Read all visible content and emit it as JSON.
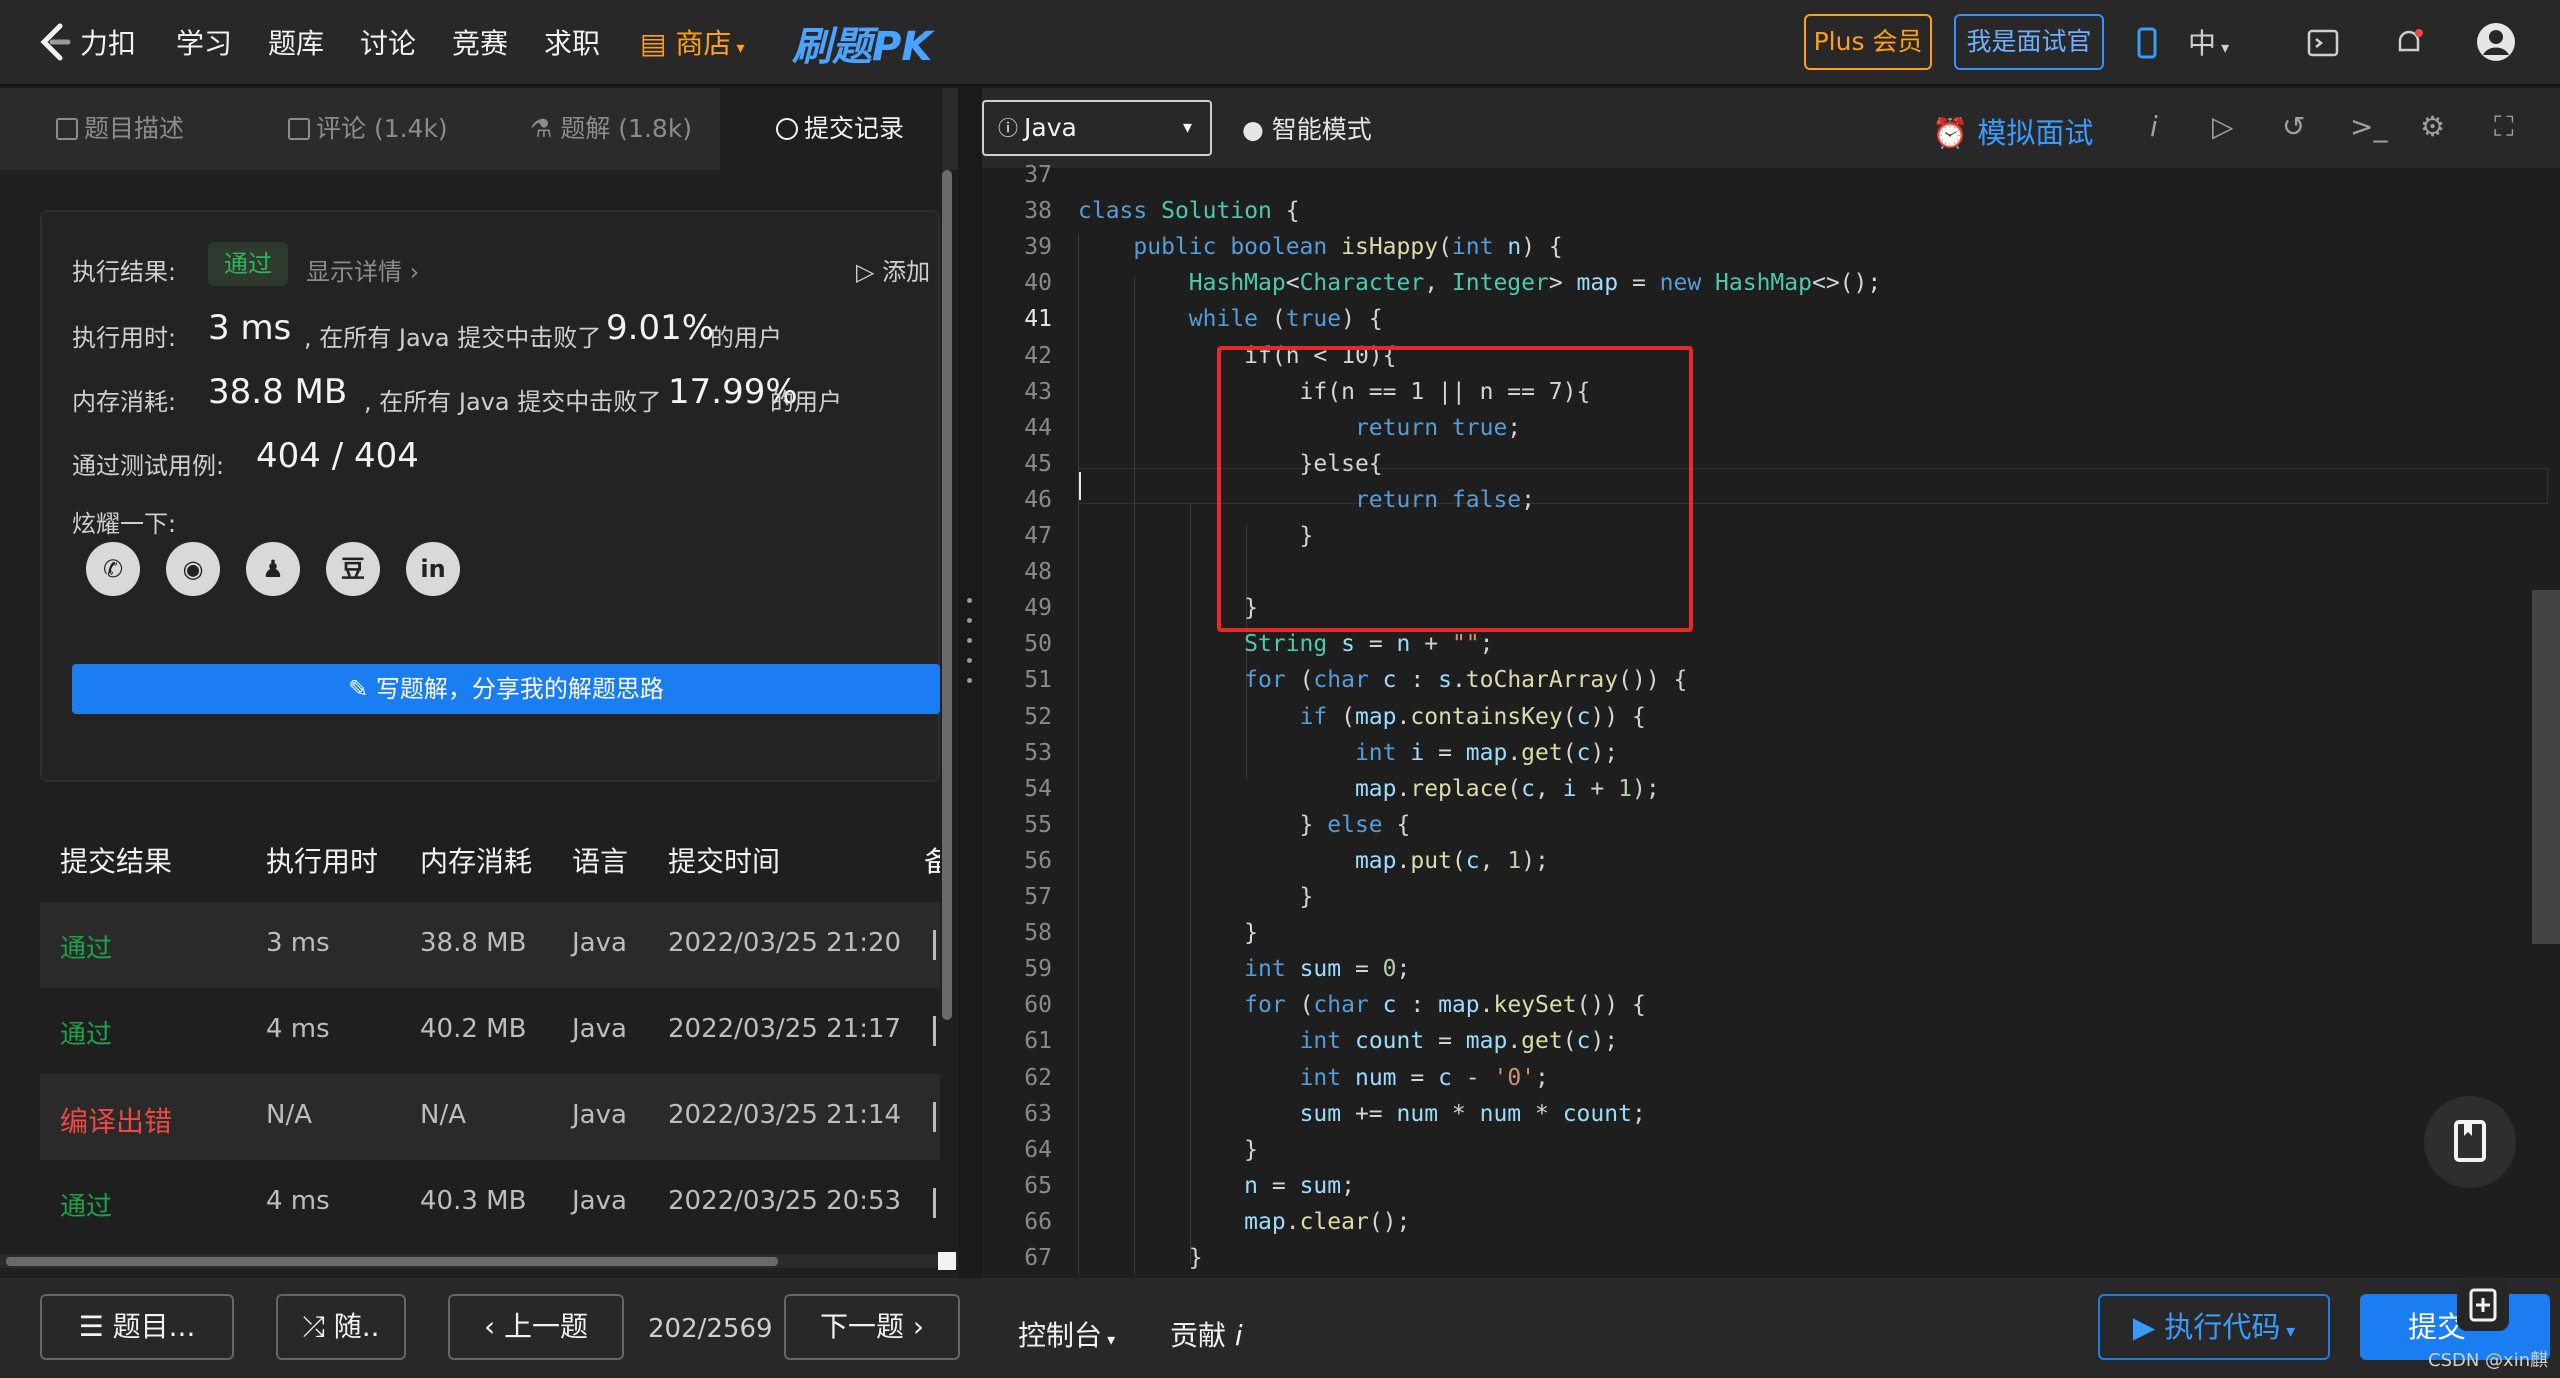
{
  "nav": {
    "logo_text": "力扣",
    "items": [
      "学习",
      "题库",
      "讨论",
      "竞赛",
      "求职"
    ],
    "shop": "商店",
    "pk": "刷题PK",
    "plus": "Plus 会员",
    "interviewer": "我是面试官",
    "lang": "中"
  },
  "tabs": [
    "题目描述",
    "评论 (1.4k)",
    "题解 (1.8k)",
    "提交记录"
  ],
  "result": {
    "label_result": "执行结果:",
    "status": "通过",
    "show_detail": "显示详情",
    "add": "添加",
    "label_time": "执行用时:",
    "time_value": "3 ms",
    "time_text": ", 在所有 Java 提交中击败了",
    "time_pct": "9.01%",
    "time_suffix": "的用户",
    "label_mem": "内存消耗:",
    "mem_value": "38.8 MB",
    "mem_text": ", 在所有 Java 提交中击败了",
    "mem_pct": "17.99%",
    "mem_suffix": "的用户",
    "label_cases": "通过测试用例:",
    "cases_value": "404 / 404",
    "label_share": "炫耀一下:",
    "write_btn": "写题解，分享我的解题思路"
  },
  "table": {
    "headers": [
      "提交结果",
      "执行用时",
      "内存消耗",
      "语言",
      "提交时间",
      "备"
    ],
    "rows": [
      {
        "status": "通过",
        "time": "3 ms",
        "mem": "38.8 MB",
        "lang": "Java",
        "date": "2022/03/25 21:20"
      },
      {
        "status": "通过",
        "time": "4 ms",
        "mem": "40.2 MB",
        "lang": "Java",
        "date": "2022/03/25 21:17"
      },
      {
        "status": "编译出错",
        "time": "N/A",
        "mem": "N/A",
        "lang": "Java",
        "date": "2022/03/25 21:14"
      },
      {
        "status": "通过",
        "time": "4 ms",
        "mem": "40.3 MB",
        "lang": "Java",
        "date": "2022/03/25 20:53"
      }
    ]
  },
  "bottom": {
    "problems": "题目...",
    "random": "随..",
    "prev": "上一题",
    "page": "202/2569",
    "next": "下一题",
    "console": "控制台",
    "contribute": "贡献",
    "run": "执行代码",
    "submit": "提交",
    "watermark": "CSDN @xin麒"
  },
  "editor": {
    "language": "Java",
    "smart_mode": "智能模式",
    "mock_interview": "模拟面试",
    "current_line": 41,
    "line_numbers": [
      37,
      38,
      39,
      40,
      41,
      42,
      43,
      44,
      45,
      46,
      47,
      48,
      49,
      50,
      51,
      52,
      53,
      54,
      55,
      56,
      57,
      58,
      59,
      60,
      61,
      62,
      63,
      64,
      65,
      66,
      67
    ]
  },
  "colors": {
    "accent": "#1a7ef2",
    "pass": "#1aa34a",
    "error": "#ef4743",
    "plus": "#ffa116",
    "highlight_box": "#e8292a"
  }
}
